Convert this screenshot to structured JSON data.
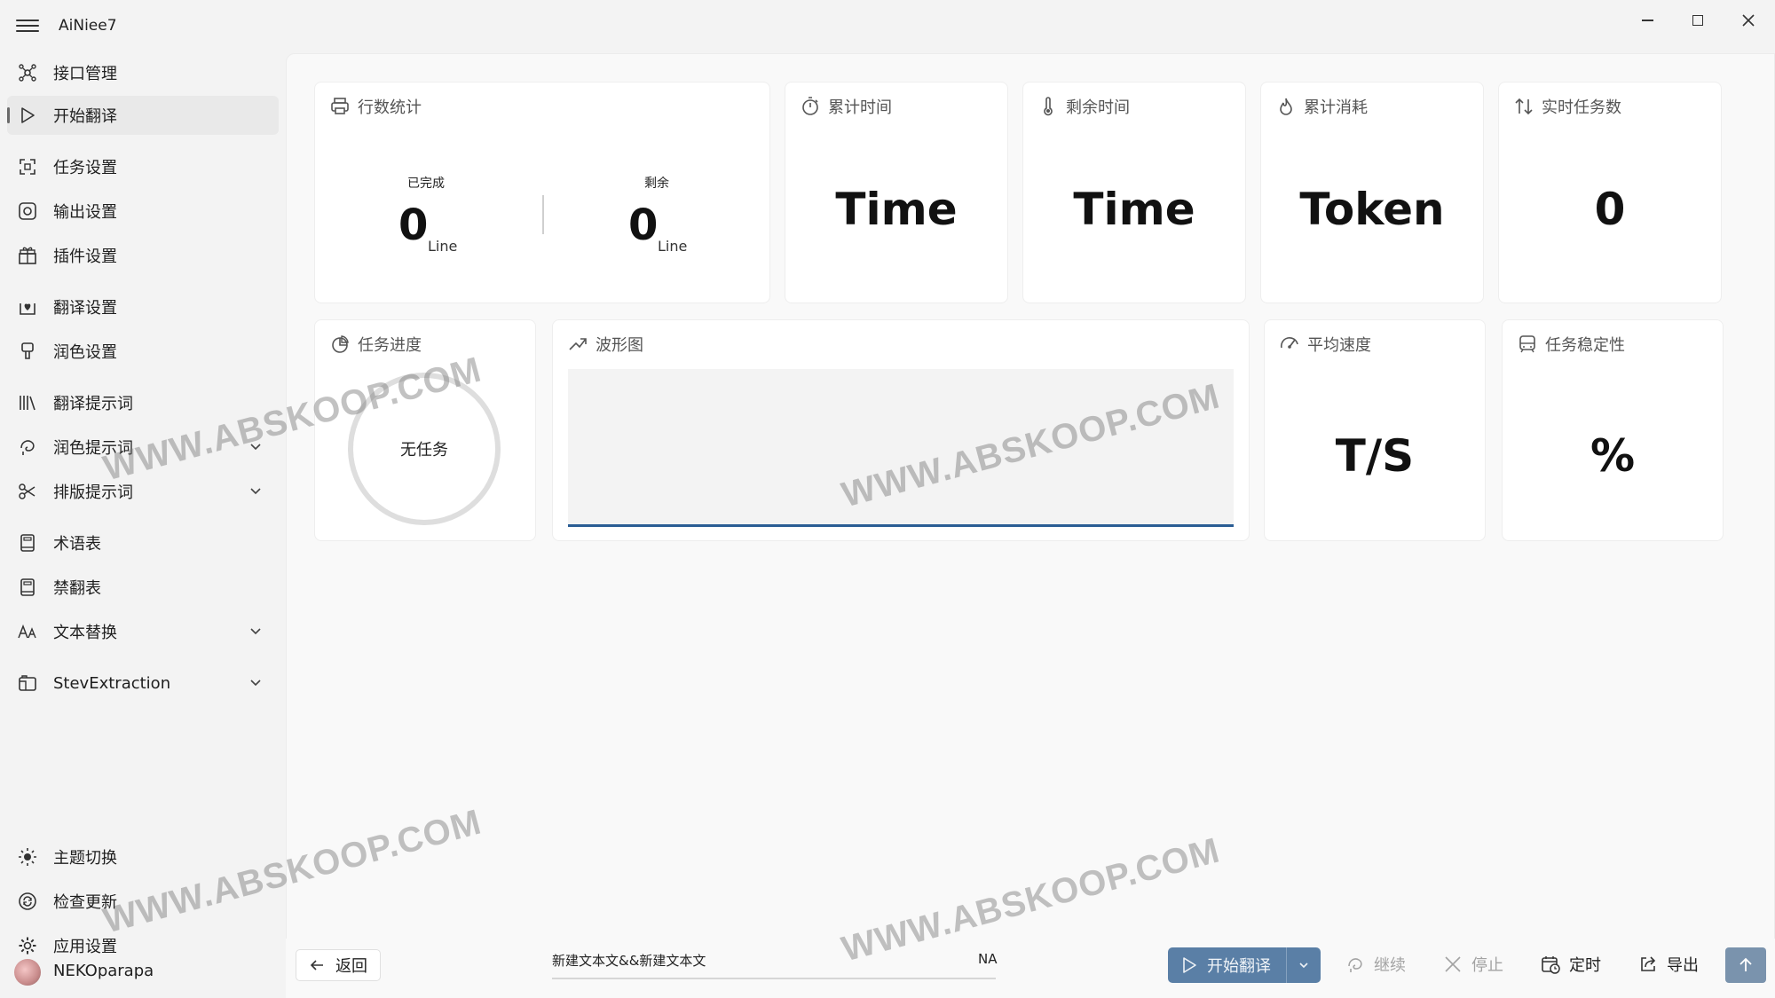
{
  "app": {
    "title": "AiNiee7"
  },
  "sidebar": {
    "items": [
      {
        "label": "接口管理",
        "icon": "interface-icon"
      },
      {
        "label": "开始翻译",
        "icon": "play-icon",
        "active": true
      },
      {
        "label": "任务设置",
        "icon": "task-settings-icon"
      },
      {
        "label": "输出设置",
        "icon": "output-settings-icon"
      },
      {
        "label": "插件设置",
        "icon": "plugin-icon"
      },
      {
        "label": "翻译设置",
        "icon": "translate-settings-icon"
      },
      {
        "label": "润色设置",
        "icon": "polish-settings-icon"
      },
      {
        "label": "翻译提示词",
        "icon": "library-icon"
      },
      {
        "label": "润色提示词",
        "icon": "polish-prompt-icon",
        "expandable": true
      },
      {
        "label": "排版提示词",
        "icon": "layout-prompt-icon",
        "expandable": true
      },
      {
        "label": "术语表",
        "icon": "glossary-icon"
      },
      {
        "label": "禁翻表",
        "icon": "no-translate-icon"
      },
      {
        "label": "文本替换",
        "icon": "text-replace-icon",
        "expandable": true
      },
      {
        "label": "StevExtraction",
        "icon": "extraction-icon",
        "expandable": true
      }
    ],
    "bottom_items": [
      {
        "label": "主题切换",
        "icon": "sun-icon"
      },
      {
        "label": "检查更新",
        "icon": "update-icon"
      },
      {
        "label": "应用设置",
        "icon": "gear-icon"
      }
    ],
    "user": "NEKOparapa"
  },
  "stats": {
    "line_count": {
      "title": "行数统计",
      "completed_label": "已完成",
      "completed": "0",
      "remaining_label": "剩余",
      "remaining": "0",
      "unit": "Line"
    },
    "elapsed_time": {
      "title": "累计时间",
      "value": "Time"
    },
    "remaining_time": {
      "title": "剩余时间",
      "value": "Time"
    },
    "token_usage": {
      "title": "累计消耗",
      "value": "Token"
    },
    "realtime_tasks": {
      "title": "实时任务数",
      "value": "0"
    },
    "progress": {
      "title": "任务进度",
      "value": "无任务"
    },
    "waveform": {
      "title": "波形图"
    },
    "avg_speed": {
      "title": "平均速度",
      "value": "T/S"
    },
    "stability": {
      "title": "任务稳定性",
      "value": "%"
    }
  },
  "commandbar": {
    "back": "返回",
    "file_name": "新建文本文&&新建文本文",
    "file_status": "NA",
    "start": "开始翻译",
    "continue": "继续",
    "stop": "停止",
    "schedule": "定时",
    "export": "导出"
  },
  "watermark": "WWW.ABSKOOP.COM",
  "colors": {
    "primary": "#5a7fa6",
    "wave_line": "#2a5d94",
    "active_bg": "#e9e9e9"
  }
}
